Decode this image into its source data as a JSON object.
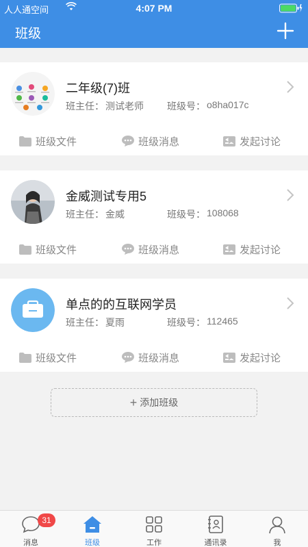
{
  "status_bar": {
    "carrier": "人人通空间",
    "time": "4:07 PM"
  },
  "nav": {
    "title": "班级"
  },
  "labels": {
    "teacher": "班主任：",
    "code": "班级号："
  },
  "classes": [
    {
      "name": "二年级(7)班",
      "teacher": "测试老师",
      "code": "o8ha017c"
    },
    {
      "name": "金威测试专用5",
      "teacher": "金威",
      "code": "108068"
    },
    {
      "name": "单点的的互联网学员",
      "teacher": "夏雨",
      "code": "112465"
    }
  ],
  "actions": {
    "files": "班级文件",
    "messages": "班级消息",
    "discuss": "发起讨论"
  },
  "add_class": "添加班级",
  "tabs": [
    {
      "label": "消息",
      "icon": "chat-bubble-icon",
      "badge": "31"
    },
    {
      "label": "班级",
      "icon": "house-icon",
      "active": true
    },
    {
      "label": "工作",
      "icon": "grid-icon"
    },
    {
      "label": "通讯录",
      "icon": "contacts-book-icon"
    },
    {
      "label": "我",
      "icon": "person-icon"
    }
  ],
  "colors": {
    "brand": "#3e8ee5",
    "badge": "#f04848",
    "background": "#f2f2f2"
  }
}
